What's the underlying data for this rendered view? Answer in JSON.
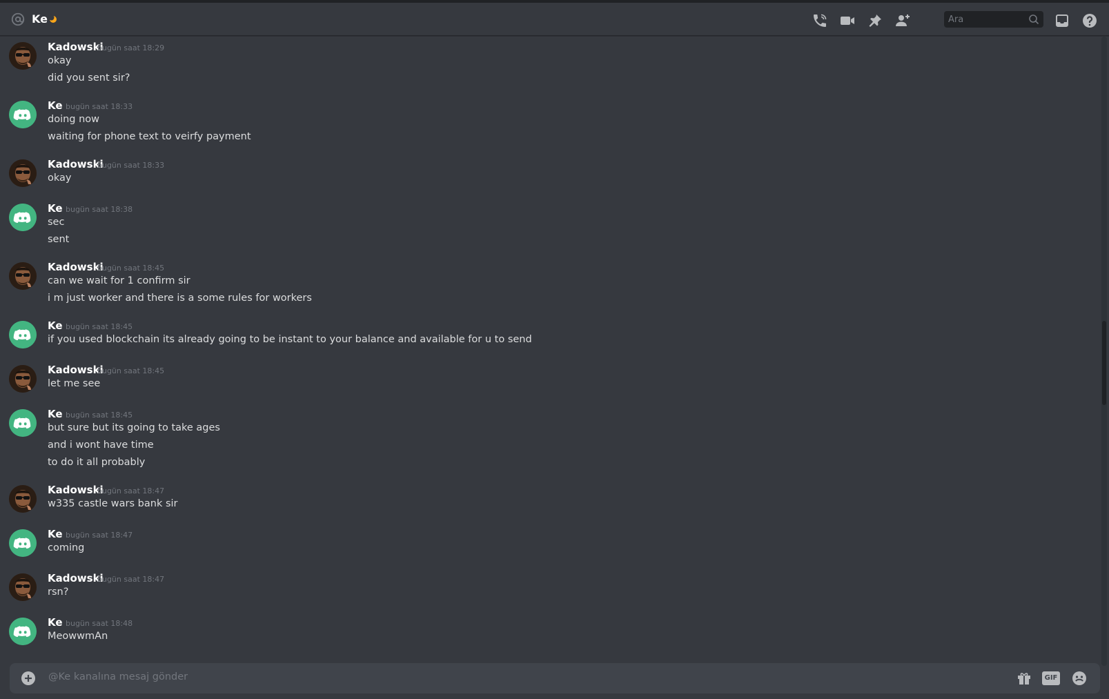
{
  "header": {
    "title": "Ke",
    "search_placeholder": "Ara",
    "icons": [
      "at-icon",
      "moon-status-icon",
      "voice-call-icon",
      "video-call-icon",
      "pin-icon",
      "add-friend-icon",
      "search-icon",
      "inbox-icon",
      "help-icon"
    ]
  },
  "messages": [
    {
      "author": "Kadowski",
      "time": "bugün saat 18:29",
      "lines": [
        "okay",
        "did you sent sir?"
      ],
      "avatar": "kadowski"
    },
    {
      "author": "Ke",
      "time": "bugün saat 18:33",
      "lines": [
        "doing now",
        "waiting for phone text to veirfy payment"
      ],
      "avatar": "discord"
    },
    {
      "author": "Kadowski",
      "time": "bugün saat 18:33",
      "lines": [
        "okay"
      ],
      "avatar": "kadowski"
    },
    {
      "author": "Ke",
      "time": "bugün saat 18:38",
      "lines": [
        "sec",
        "sent"
      ],
      "avatar": "discord"
    },
    {
      "author": "Kadowski",
      "time": "bugün saat 18:45",
      "lines": [
        "can we wait for 1 confirm sir",
        "i m just worker and there is a some rules for workers"
      ],
      "avatar": "kadowski"
    },
    {
      "author": "Ke",
      "time": "bugün saat 18:45",
      "lines": [
        "if you used blockchain its already going to be instant to your balance and available for u to send"
      ],
      "avatar": "discord"
    },
    {
      "author": "Kadowski",
      "time": "bugün saat 18:45",
      "lines": [
        "let me see"
      ],
      "avatar": "kadowski"
    },
    {
      "author": "Ke",
      "time": "bugün saat 18:45",
      "lines": [
        "but sure but its going to take ages",
        "and i wont have time",
        "to do it all probably"
      ],
      "avatar": "discord"
    },
    {
      "author": "Kadowski",
      "time": "bugün saat 18:47",
      "lines": [
        "w335 castle wars bank sir"
      ],
      "avatar": "kadowski"
    },
    {
      "author": "Ke",
      "time": "bugün saat 18:47",
      "lines": [
        "coming"
      ],
      "avatar": "discord"
    },
    {
      "author": "Kadowski",
      "time": "bugün saat 18:47",
      "lines": [
        "rsn?"
      ],
      "avatar": "kadowski"
    },
    {
      "author": "Ke",
      "time": "bugün saat 18:48",
      "lines": [
        "MeowwmAn"
      ],
      "avatar": "discord"
    }
  ],
  "composer": {
    "placeholder": "@Ke kanalına mesaj gönder",
    "gif_label": "GIF"
  },
  "colors": {
    "background": "#36393f",
    "discord_green": "#43b581",
    "composer": "#40444b"
  }
}
